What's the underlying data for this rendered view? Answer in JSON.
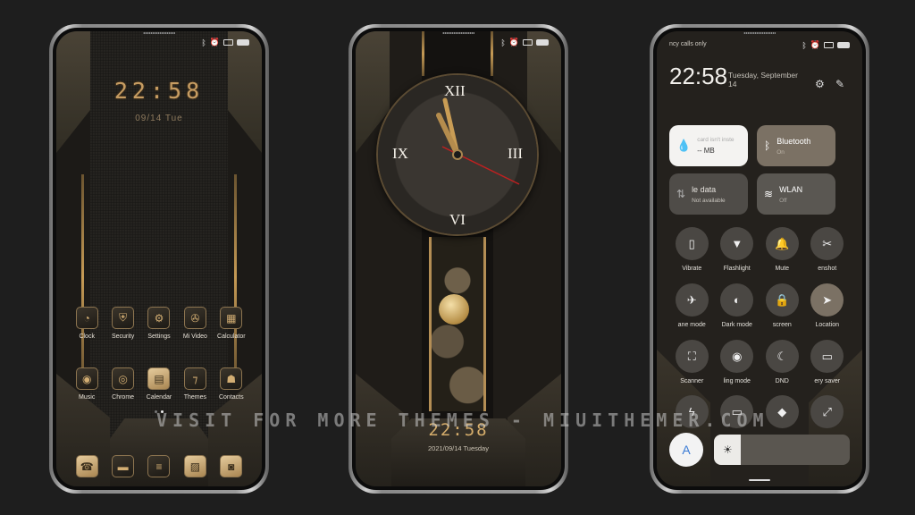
{
  "watermark": "VISIT FOR MORE THEMES - MIUITHEMER.COM",
  "colors": {
    "background": "#1e1e1e",
    "gold": "#c69c62",
    "accent_blue": "#3a7bd5"
  },
  "status_icons": [
    "bluetooth-icon",
    "alarm-icon",
    "cast-icon",
    "battery-icon"
  ],
  "phone1": {
    "lock_time": "22:58",
    "lock_date": "09/14 Tue",
    "apps_row1": [
      {
        "label": "Clock",
        "icon": "◔"
      },
      {
        "label": "Security",
        "icon": "⛨"
      },
      {
        "label": "Settings",
        "icon": "⚙"
      },
      {
        "label": "Mi Video",
        "icon": "✇"
      },
      {
        "label": "Calculator",
        "icon": "▦"
      }
    ],
    "apps_row2": [
      {
        "label": "Music",
        "icon": "◉"
      },
      {
        "label": "Chrome",
        "icon": "◎"
      },
      {
        "label": "Calendar",
        "icon": "▤"
      },
      {
        "label": "Themes",
        "icon": "⁊"
      },
      {
        "label": "Contacts",
        "icon": "☗"
      }
    ],
    "dock": [
      {
        "name": "phone",
        "icon": "☎"
      },
      {
        "name": "messages",
        "icon": "▬"
      },
      {
        "name": "notes",
        "icon": "≡"
      },
      {
        "name": "gallery",
        "icon": "▨"
      },
      {
        "name": "camera",
        "icon": "◙"
      }
    ]
  },
  "phone2": {
    "numerals": {
      "top": "XII",
      "right": "III",
      "bottom": "VI",
      "left": "IX"
    },
    "clock_time": "22:58",
    "date": "2021/09/14 Tuesday"
  },
  "phone3": {
    "carrier": "ncy calls only",
    "time": "22:58",
    "date_line1": "Tuesday, September",
    "date_line2": "14",
    "settings_icon": "⚙",
    "edit_icon": "✎",
    "tiles": [
      {
        "name": "data-usage",
        "title": "card isn't inste",
        "sub": "-- MB",
        "icon": "💧",
        "state": "light"
      },
      {
        "name": "bluetooth",
        "title": "Bluetooth",
        "sub": "On",
        "icon": "ᛒ",
        "state": "on"
      },
      {
        "name": "mobile-data",
        "title": "le data",
        "sub": "Not available",
        "icon": "⇅",
        "state": "off"
      },
      {
        "name": "wlan",
        "title": "WLAN",
        "sub": "Off",
        "icon": "≋",
        "state": "off"
      }
    ],
    "toggles": [
      {
        "label": "Vibrate",
        "icon": "▯",
        "on": false
      },
      {
        "label": "Flashlight",
        "icon": "▼",
        "on": false
      },
      {
        "label": "Mute",
        "icon": "🔔",
        "on": false
      },
      {
        "label": "enshot",
        "icon": "✂",
        "on": false
      },
      {
        "label": "ane mode",
        "icon": "✈",
        "on": false
      },
      {
        "label": "Dark mode",
        "icon": "◐",
        "on": false
      },
      {
        "label": "screen",
        "icon": "🔒",
        "on": false
      },
      {
        "label": "Location",
        "icon": "➤",
        "on": true
      },
      {
        "label": "Scanner",
        "icon": "⛶",
        "on": false
      },
      {
        "label": "ling mode",
        "icon": "◉",
        "on": false
      },
      {
        "label": "DND",
        "icon": "☾",
        "on": false
      },
      {
        "label": "ery saver",
        "icon": "▭",
        "on": false
      },
      {
        "label": "",
        "icon": "ϟ",
        "on": false
      },
      {
        "label": "",
        "icon": "▭",
        "on": false
      },
      {
        "label": "",
        "icon": "◆",
        "on": false
      },
      {
        "label": "",
        "icon": "⤢",
        "on": false
      }
    ],
    "auto_brightness_label": "A",
    "brightness_icon": "☀",
    "brightness_level": 0.2
  }
}
